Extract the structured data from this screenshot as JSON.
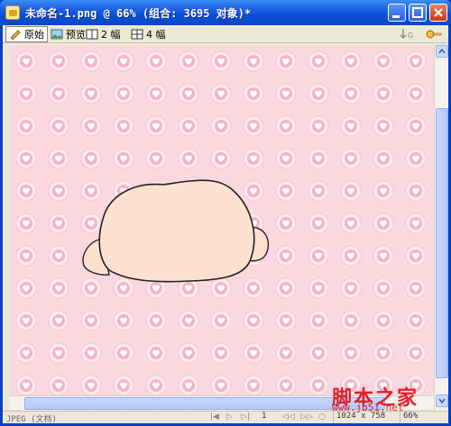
{
  "window": {
    "title": "未命名-1.png @  66% (组合: 3695 对象)*"
  },
  "toolbar": {
    "original_label": "原始",
    "preview_label": "预览",
    "two_up_label": "2 幅",
    "four_up_label": "4 幅"
  },
  "status": {
    "format": "JPEG (文档)",
    "page_number": "1",
    "image_size": "1024 x 758",
    "zoom": "66%"
  },
  "watermark": {
    "text": "脚本之家",
    "url": "www.jb51.net"
  },
  "colors": {
    "canvas_bg": "#fbd7e0",
    "shape_fill": "#fde0d0",
    "shape_stroke": "#222222",
    "titlebar": "#0a4fd8",
    "watermark": "#e0202a"
  },
  "icons": {
    "original": "pencil-icon",
    "preview": "image-preview-icon",
    "two_up": "two-pane-icon",
    "four_up": "four-pane-icon"
  }
}
